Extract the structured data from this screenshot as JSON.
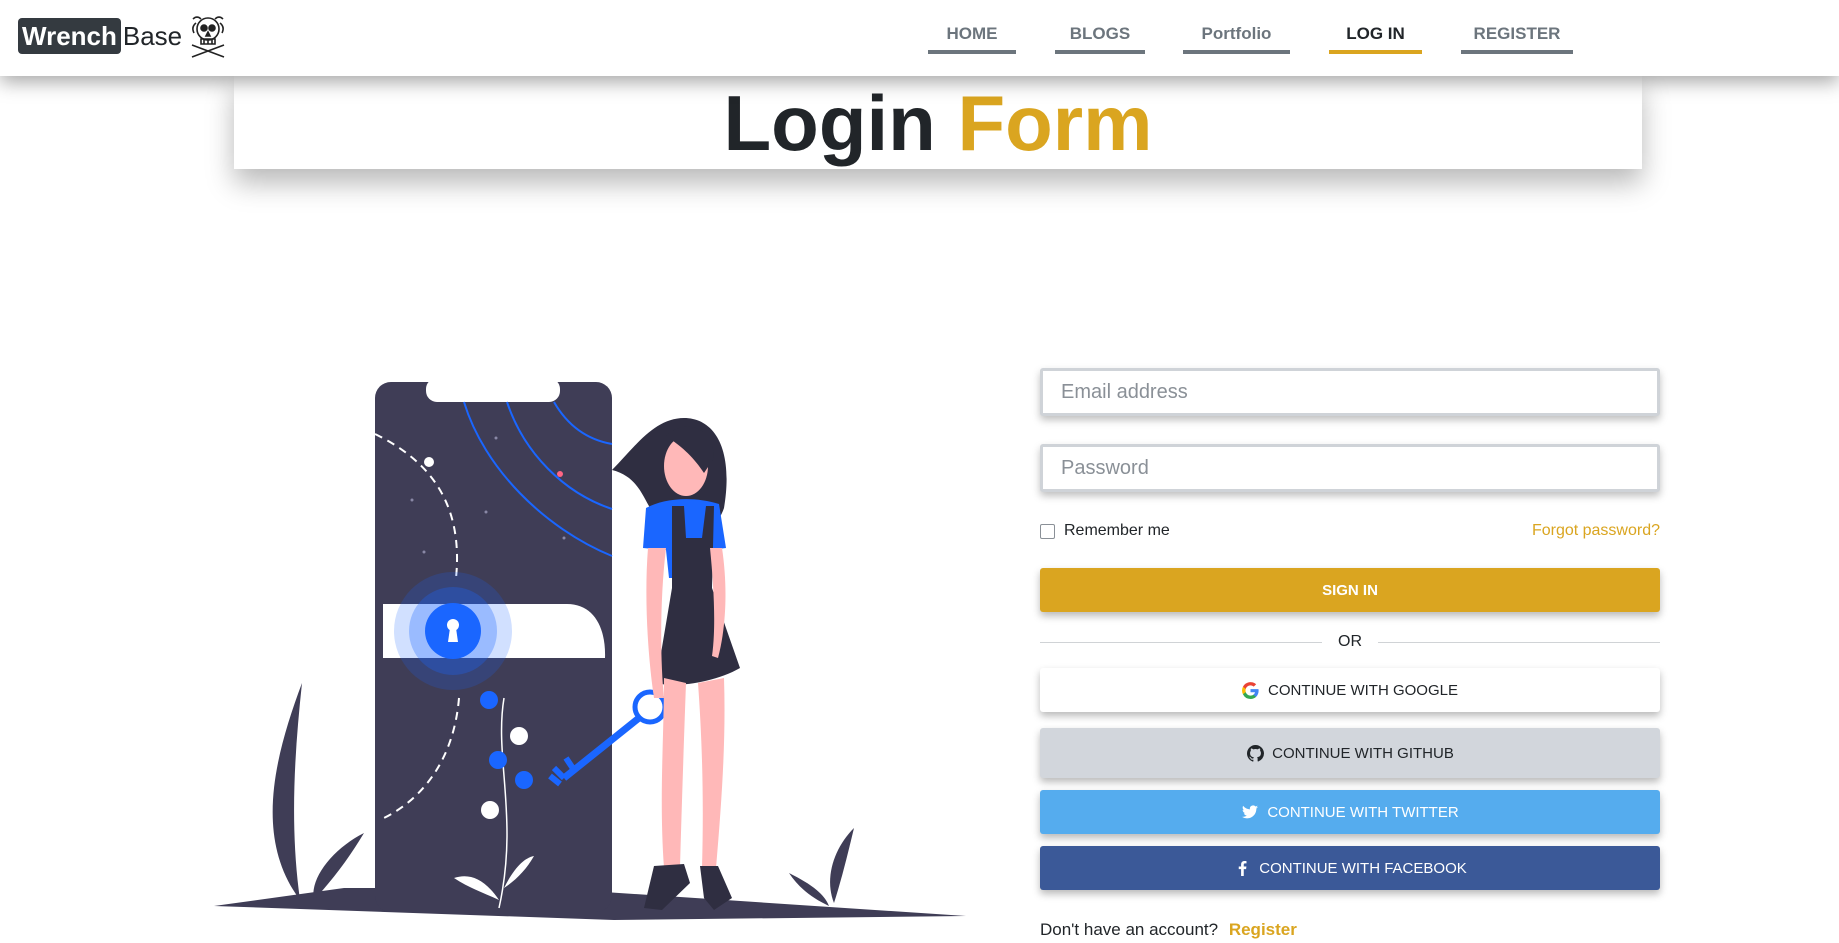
{
  "brand": {
    "name_boxed": "Wrench",
    "name_rest": "Base",
    "logo_icon": "skull-crossbones-icon"
  },
  "nav": {
    "items": [
      {
        "label": "HOME",
        "active": false
      },
      {
        "label": "BLOGS",
        "active": false
      },
      {
        "label": "Portfolio",
        "active": false
      },
      {
        "label": "LOG IN",
        "active": true
      },
      {
        "label": "REGISTER",
        "active": false
      }
    ]
  },
  "title": {
    "part1": "Login",
    "part2": "Form"
  },
  "form": {
    "email_placeholder": "Email address",
    "email_value": "",
    "password_placeholder": "Password",
    "password_value": "",
    "remember_label": "Remember me",
    "remember_checked": false,
    "forgot_label": "Forgot password?",
    "signin_label": "SIGN IN",
    "or_label": "OR",
    "google_label": "CONTINUE WITH GOOGLE",
    "github_label": "CONTINUE WITH GITHUB",
    "twitter_label": "CONTINUE WITH TWITTER",
    "facebook_label": "CONTINUE WITH FACEBOOK",
    "signup_prompt": "Don't have an account?",
    "signup_link": "Register"
  },
  "colors": {
    "accent": "#daa520",
    "dark": "#212529",
    "nav_inactive": "#6c757d",
    "google_bg": "#ffffff",
    "github_bg": "#d2d6dc",
    "twitter_bg": "#55acee",
    "facebook_bg": "#3b5998",
    "illustration_primary": "#1a66ff",
    "illustration_dark": "#3f3d56"
  },
  "icons": {
    "google": "google-icon",
    "github": "github-icon",
    "twitter": "twitter-icon",
    "facebook": "facebook-icon"
  }
}
